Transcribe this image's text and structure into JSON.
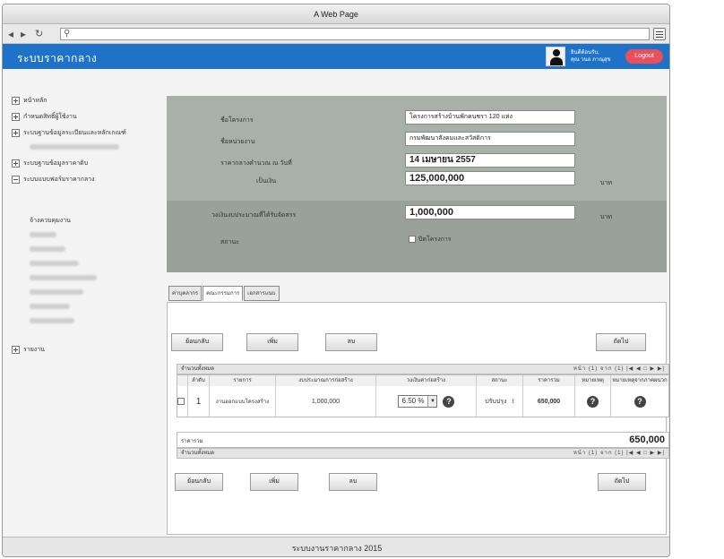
{
  "browser": {
    "title": "A Web Page",
    "url": ""
  },
  "header": {
    "brand": "ระบบราคากลาง",
    "welcome_line1": "ยินดีต้อนรับ,",
    "welcome_line2": "คุณ วนอ ภาณุสุข",
    "logout_label": "Logout"
  },
  "sidebar": {
    "items": [
      {
        "label": "หน้าหลัก",
        "icon": "plus-box-icon"
      },
      {
        "label": "กำหนดสิทธิ์ผู้ใช้งาน",
        "icon": "plus-box-icon"
      },
      {
        "label": "ระบบฐานข้อมูลระเบียนและหลักเกณฑ์",
        "icon": "plus-box-icon"
      },
      {
        "label": "ระบบฐานข้อมูลราคาดิบ",
        "icon": "plus-box-icon"
      },
      {
        "label": "ระบบแบบฟอร์มราคากลาง",
        "icon": "minus-box-icon"
      },
      {
        "label": "จ้างควบคุมงาน",
        "icon": ""
      },
      {
        "label": "รายงาน",
        "icon": "plus-box-icon"
      }
    ]
  },
  "form": {
    "project_label": "ชื่อโครงการ",
    "project_value": "โครงการสร้างบ้านพักคนชรา 120 แห่ง",
    "agency_label": "ชื่อหน่วยงาน",
    "agency_value": "กรมพัฒนาสังคมและสวัสดิการ",
    "date_label": "ราคากลางคำนวณ ณ วันที่",
    "date_value": "14 เมษายน 2557",
    "amount_label": "เป็นเงิน",
    "amount_value": "125,000,000",
    "amount_unit": "บาท",
    "budget_label": "วงเงินงบประมาณที่ได้รับจัดสรร",
    "budget_value": "1,000,000",
    "budget_unit": "บาท",
    "status_label": "สถานะ",
    "status_checkbox": "ปิดโครงการ"
  },
  "tabs": [
    "ค่าบุคลากร",
    "คณะกรรมการ",
    "เอกสารแนบ"
  ],
  "toolbar": {
    "back": "ย้อนกลับ",
    "add": "เพิ่ม",
    "delete": "ลบ",
    "next": "ถัดไป"
  },
  "grid": {
    "bar_label": "จำนวนทั้งหมด",
    "pager_text": "หน้า (1) จาก (1)  |◀ ◀ □ ▶ ▶|",
    "headers": [
      "",
      "ลำดับ",
      "รายการ",
      "งบประมาณการก่อสร้าง",
      "วงเงินค่าก่อสร้าง",
      "สถานะ",
      "ราคารวม",
      "หมายเหตุ",
      "หมายเหตุจากภาคผนวก"
    ],
    "row": {
      "index": "1",
      "item": "งานออกแบบโครงสร้าง",
      "budget": "1,000,000",
      "percent": "6.50 %",
      "status": "ปรับปรุง",
      "total": "650,000"
    },
    "sum_label": "ราคารวม",
    "sum_value": "650,000"
  },
  "footer": {
    "text": "ระบบงานราคากลาง 2015"
  }
}
